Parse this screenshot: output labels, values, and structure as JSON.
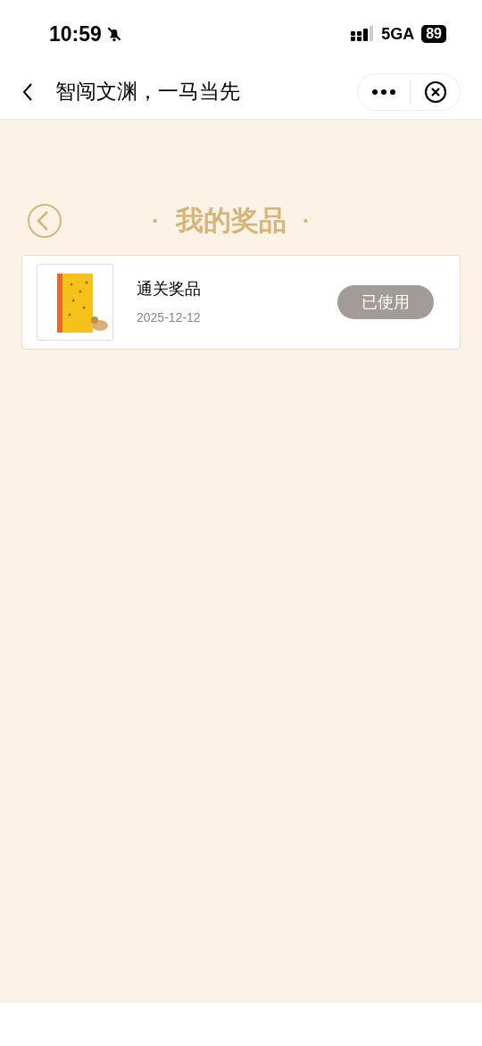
{
  "status_bar": {
    "time": "10:59",
    "network": "5GA",
    "battery": "89"
  },
  "nav": {
    "title": "智闯文渊，一马当先"
  },
  "header": {
    "title": "我的奖品",
    "dot_left": "·",
    "dot_right": "·"
  },
  "prizes": [
    {
      "name": "通关奖品",
      "date": "2025-12-12",
      "status": "已使用",
      "used": true
    }
  ]
}
